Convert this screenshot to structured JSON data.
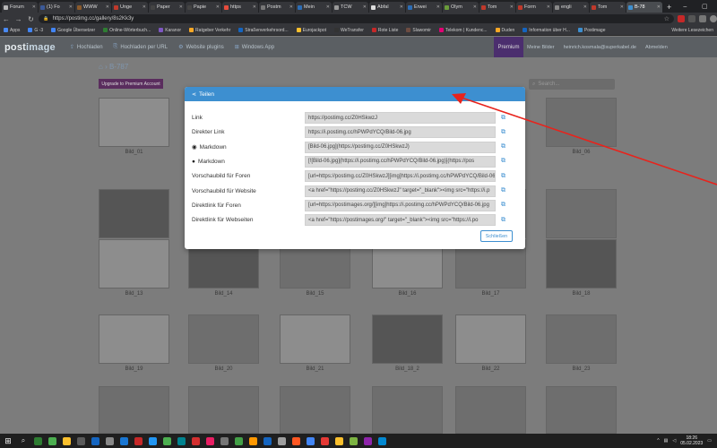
{
  "browser": {
    "tabs": [
      {
        "label": "Forum",
        "color": "#b7b7b7"
      },
      {
        "label": "(1) Fo",
        "color": "#3b5998"
      },
      {
        "label": "WWW",
        "color": "#8b5a2b"
      },
      {
        "label": "Unge",
        "color": "#c0392b"
      },
      {
        "label": "Paper",
        "color": "#444444"
      },
      {
        "label": "Papie",
        "color": "#444444"
      },
      {
        "label": "https",
        "color": "#e74c3c"
      },
      {
        "label": "Postm",
        "color": "#777777"
      },
      {
        "label": "Mein",
        "color": "#2c6db5"
      },
      {
        "label": "TCW",
        "color": "#999999"
      },
      {
        "label": "Abfal",
        "color": "#dddddd"
      },
      {
        "label": "Erwei",
        "color": "#2c6db5"
      },
      {
        "label": "Olym",
        "color": "#6a9b3a"
      },
      {
        "label": "Tom",
        "color": "#c0392b"
      },
      {
        "label": "Form",
        "color": "#c0392b"
      },
      {
        "label": "engli",
        "color": "#888888"
      },
      {
        "label": "Tom",
        "color": "#c0392b"
      },
      {
        "label": "B-78",
        "color": "#3d8fd0",
        "active": true
      }
    ],
    "new_tab": "+",
    "window_controls": [
      "–",
      "▢",
      "✕"
    ],
    "url": "https://postimg.cc/gallery/8s2Kk3y",
    "bookmarks": [
      {
        "label": "Apps",
        "color": "#4a8af4"
      },
      {
        "label": "G -3",
        "color": "#4285f4"
      },
      {
        "label": "Google Übersetzer",
        "color": "#4285f4"
      },
      {
        "label": "Online-Wörterbuch...",
        "color": "#2e7d32"
      },
      {
        "label": "Karanor",
        "color": "#7e57c2"
      },
      {
        "label": "Ratgeber Verkehr",
        "color": "#f9a825"
      },
      {
        "label": "Straßenverkehrsord...",
        "color": "#1565c0"
      },
      {
        "label": "Eurojackpot",
        "color": "#fbc02d"
      },
      {
        "label": "WeTransfer",
        "color": "#333333"
      },
      {
        "label": "Rote Liste",
        "color": "#c62828"
      },
      {
        "label": "Slawomir",
        "color": "#6d4c41"
      },
      {
        "label": "Telekom | Kundenc...",
        "color": "#e20074"
      },
      {
        "label": "Duden",
        "color": "#f9a825"
      },
      {
        "label": "Information über H...",
        "color": "#1565c0"
      },
      {
        "label": "Postimage",
        "color": "#3d8fd0"
      }
    ],
    "bookmarks_more": "Weitere Lesezeichen"
  },
  "site": {
    "logo_a": "post",
    "logo_b": "image",
    "nav": [
      {
        "label": "Hochladen",
        "icon": "upload-icon"
      },
      {
        "label": "Hochladen per URL",
        "icon": "link-icon"
      },
      {
        "label": "Website plugins",
        "icon": "plugin-icon"
      },
      {
        "label": "Windows App",
        "icon": "windows-icon"
      }
    ],
    "premium": "Premium",
    "my_images": "Meine Bilder",
    "email": "heinrich.kosmala@superkabel.de",
    "logout": "Abmelden",
    "breadcrumb": "B-787",
    "upgrade": "Upgrade to Premium Account",
    "search_placeholder": "Search..."
  },
  "gallery": [
    {
      "name": "Bild_01"
    },
    {
      "name": "Bild_06"
    },
    {
      "name": "Bild_07"
    },
    {
      "name": "Bild_08"
    },
    {
      "name": "Bild_09"
    },
    {
      "name": "Bild_10"
    },
    {
      "name": "Bild_11"
    },
    {
      "name": "Bild_12"
    },
    {
      "name": "Bild_13"
    },
    {
      "name": "Bild_14"
    },
    {
      "name": "Bild_15"
    },
    {
      "name": "Bild_16"
    },
    {
      "name": "Bild_17"
    },
    {
      "name": "Bild_18"
    },
    {
      "name": "Bild_19"
    },
    {
      "name": "Bild_20"
    },
    {
      "name": "Bild_21"
    },
    {
      "name": "Bild_18_2"
    },
    {
      "name": "Bild_22"
    },
    {
      "name": "Bild_23"
    }
  ],
  "modal": {
    "title": "Teilen",
    "rows": [
      {
        "label": "Link",
        "value": "https://postimg.cc/Z0HSkwzJ"
      },
      {
        "label": "Direkter Link",
        "value": "https://i.postimg.cc/hPWPdYCQ/Bild-06.jpg"
      },
      {
        "label": "Markdown",
        "value": "[Bild-06.jpg](https://postimg.cc/Z0HSkwzJ)"
      },
      {
        "label": "Markdown",
        "value": "[![Bild-06.jpg](https://i.postimg.cc/hPWPdYCQ/Bild-06.jpg)](https://pos"
      },
      {
        "label": "Vorschaubild für Foren",
        "value": "[url=https://postimg.cc/Z0HSkwzJ][img]https://i.postimg.cc/hPWPdYCQ/Bild-06.jpg"
      },
      {
        "label": "Vorschaubild für Website",
        "value": "<a href=\"https://postimg.cc/Z0HSkwzJ\" target=\"_blank\"><img src=\"https://i.p"
      },
      {
        "label": "Direktlink für Foren",
        "value": "[url=https://postimages.org/][img]https://i.postimg.cc/hPWPdYCQ/Bild-06.jpg"
      },
      {
        "label": "Direktlink für Webseiten",
        "value": "<a href=\"https://postimages.org/\" target=\"_blank\"><img src=\"https://i.po"
      }
    ],
    "close": "Schließen"
  },
  "taskbar": {
    "time": "18:26",
    "date": "05.02.2023",
    "apps": [
      "#2e7d32",
      "#4caf50",
      "#fbc02d",
      "#5a5a5a",
      "#1565c0",
      "#888",
      "#1976d2",
      "#c62828",
      "#2196f3",
      "#4caf50",
      "#00838f",
      "#d32f2f",
      "#e91e63",
      "#757575",
      "#43a047",
      "#ff9800",
      "#1565c0",
      "#9e9e9e",
      "#ff5722",
      "#4285f4",
      "#e53935",
      "#fbc02d",
      "#7cb342",
      "#8e24aa",
      "#0288d1"
    ]
  }
}
